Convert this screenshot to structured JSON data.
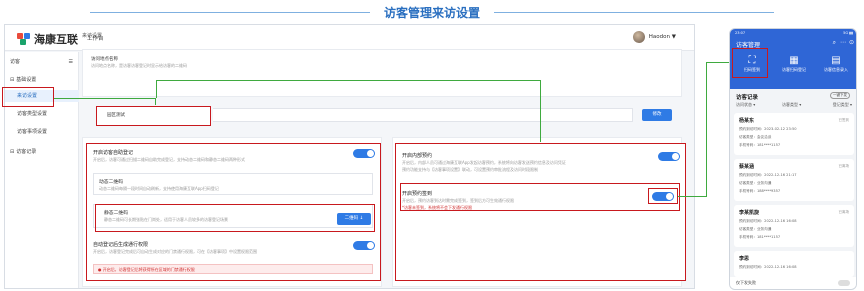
{
  "banner": {
    "title": "访客管理来访设置"
  },
  "desktop": {
    "logo": "海康互联",
    "nav": "工作台",
    "user": "Haodon ▼",
    "sidebar": {
      "top": "访客",
      "group1": "基础设置",
      "items": [
        "来访设置",
        "访客类型设置",
        "访客事项设置"
      ],
      "group2": "访客记录"
    },
    "breadcrumb": "来访设置",
    "address": {
      "label": "访问地点名称",
      "hint": "访问地点名称，是访客访客登记时显示给访客的二维码",
      "value": "园区测试",
      "button": "修改"
    },
    "left_panel": {
      "reg_title": "开启访客自助登记",
      "reg_hint": "开启后，访客可通过扫描二维码自助完成登记，支持动态二维码和静态二维码两种形式",
      "dynamic_title": "动态二维码",
      "dynamic_hint": "动态二维码每隔一段时间自动刷新，支持使用海康互联App扫码登记",
      "static_title": "静态二维码",
      "static_hint": "静态二维码可长期张贴在门岗处，适用于访客人员较多的访客登记场景",
      "static_button": "二维码 ↓",
      "perm_title": "自动登记后生成通行权限",
      "perm_hint": "开启后，访客登记完成后可自动生成对应的门禁通行权限，可在【访客事项】中设置权限范围",
      "perm_warn": "开启后，访客登记后将获得所在区域的门禁通行权限"
    },
    "right_panel": {
      "invite_title": "开启内部预约",
      "invite_hint1": "开启后，内部人员可通过海康互联App发起访客预约，系统将向访客发送预约信息及访问凭证",
      "invite_hint2": "预约功能支持与【访客事项设置】联动，可设置预约审批流程及访问时段限制",
      "appt_title": "开启预约签到",
      "appt_hint": "开启后，预约访客到达时需完成签到，签到后方可生效通行权限",
      "appt_warn": "*访客未签到，系统将不会下发通行权限"
    }
  },
  "phone": {
    "time": "23:07",
    "battery": "5G ▮▮",
    "title": "访客管理",
    "tiles": [
      "扫码签到",
      "访客扫码登记",
      "访客信息录入"
    ],
    "section": "访客记录",
    "tag": "一键下发",
    "filters": [
      "访问状态 ▾",
      "访客类型 ▾",
      "登记类型 ▾"
    ],
    "records": [
      {
        "name": "杨某东",
        "status": "已签到",
        "time": "预约到访时间：2023-02-12 23:50",
        "type": "访客类型：会议洽谈",
        "phone": "手机号码：181****1157"
      },
      {
        "name": "蔡某涵",
        "status": "已离场",
        "time": "预约到访时间：2022-12-16 21:17",
        "type": "访客类型：业务沟通",
        "phone": "手机号码：188****9357"
      },
      {
        "name": "李某凯旋",
        "status": "已离场",
        "time": "预约到访时间：2022-12-16 16:08",
        "type": "访客类型：业务沟通",
        "phone": "手机号码：181****1157"
      },
      {
        "name": "李思",
        "status": "",
        "time": "预约到访时间：2022-12-16 16:08",
        "type": "",
        "phone": ""
      }
    ],
    "footer": "仅下发失败"
  }
}
